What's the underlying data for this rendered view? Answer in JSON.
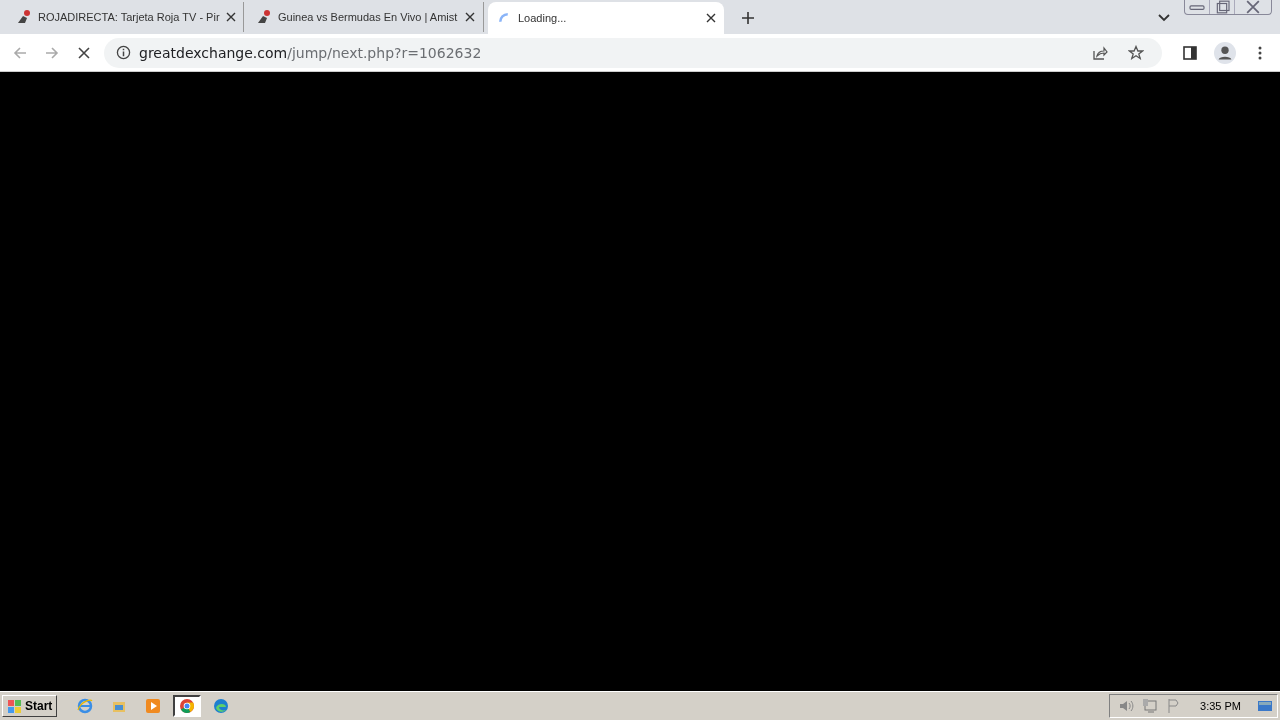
{
  "tabs": [
    {
      "title": "ROJADIRECTA: Tarjeta Roja TV - Pir",
      "selected": false,
      "loading": false
    },
    {
      "title": "Guinea vs Bermudas En Vivo | Amist",
      "selected": false,
      "loading": false
    },
    {
      "title": "Loading...",
      "selected": true,
      "loading": true
    }
  ],
  "address_bar": {
    "host": "greatdexchange.com",
    "path": "/jump/next.php?r=1062632"
  },
  "taskbar": {
    "start_label": "Start",
    "apps": [
      {
        "kind": "ie",
        "selected": false
      },
      {
        "kind": "folder",
        "selected": false
      },
      {
        "kind": "media",
        "selected": false
      },
      {
        "kind": "chrome",
        "selected": true
      },
      {
        "kind": "edge",
        "selected": false
      }
    ],
    "clock": "3:35 PM"
  }
}
